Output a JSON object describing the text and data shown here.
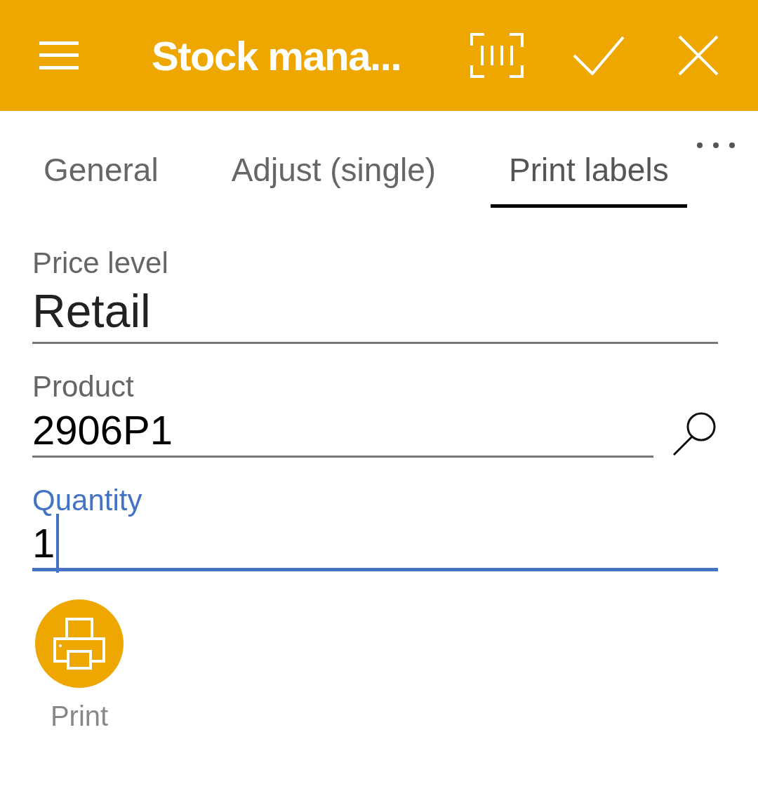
{
  "header": {
    "title": "Stock mana..."
  },
  "tabs": [
    {
      "label": "General",
      "selected": false
    },
    {
      "label": "Adjust (single)",
      "selected": false
    },
    {
      "label": "Print labels",
      "selected": true
    }
  ],
  "fields": [
    {
      "kind": "text",
      "label": "Price level",
      "value": "Retail",
      "focused": false
    },
    {
      "kind": "lookup",
      "label": "Product",
      "value": "2906P1",
      "focused": false
    },
    {
      "kind": "text",
      "label": "Quantity",
      "value": "1",
      "focused": true
    }
  ],
  "actions": [
    {
      "label": "Print"
    }
  ]
}
